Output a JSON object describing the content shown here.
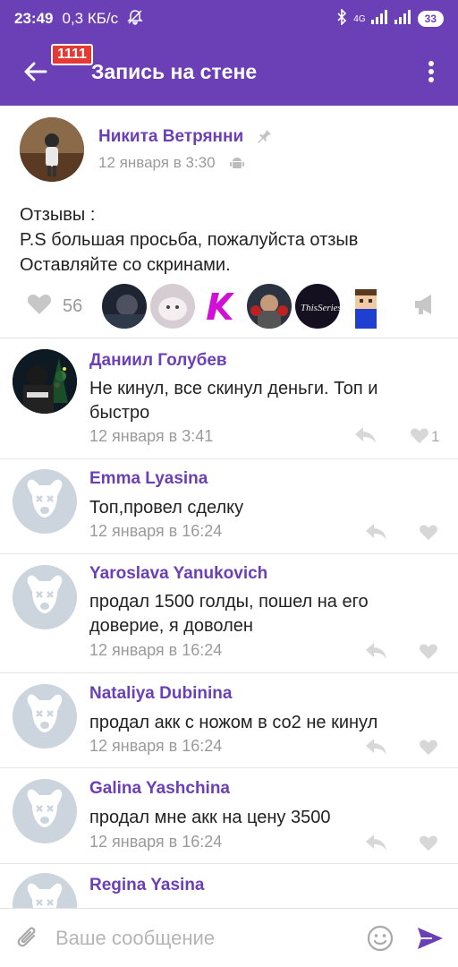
{
  "status_bar": {
    "time": "23:49",
    "speed": "0,3 КБ/с",
    "network": "4G",
    "battery": "33"
  },
  "app_bar": {
    "title": "Запись на стене",
    "badge": "1111"
  },
  "post": {
    "author": "Никита Ветрянни",
    "date": "12 января в 3:30",
    "text_lines": [
      "Отзывы :",
      "P.S большая просьба, пожалуйста отзыв",
      "Оставляйте со скринами."
    ],
    "likes_count": "56",
    "likers": [
      "dark-photo",
      "cat-photo",
      "kantik-logo",
      "fighter-photo",
      "dark-logo",
      "pixel-avatar"
    ]
  },
  "comments": [
    {
      "name": "Даниил Голубев",
      "text": "Не кинул, все скинул деньги. Топ и быстро",
      "date": "12 января в 3:41",
      "likes": "1",
      "avatar": "photo"
    },
    {
      "name": "Emma Lyasina",
      "text": "Топ,провел сделку",
      "date": "12 января в 16:24",
      "likes": "",
      "avatar": "default-dog"
    },
    {
      "name": "Yaroslava Yanukovich",
      "text": "продал 1500 голды, пошел на его доверие, я доволен",
      "date": "12 января в 16:24",
      "likes": "",
      "avatar": "default-dog"
    },
    {
      "name": "Nataliya Dubinina",
      "text": "продал акк  с ножом в со2 не кинул",
      "date": "12 января в 16:24",
      "likes": "",
      "avatar": "default-dog"
    },
    {
      "name": "Galina Yashchina",
      "text": "продал мне акк на цену 3500",
      "date": "12 января в 16:24",
      "likes": "",
      "avatar": "default-dog"
    },
    {
      "name": "Regina Yasina",
      "text": "",
      "date": "",
      "likes": "",
      "avatar": "default-dog"
    }
  ],
  "composer": {
    "placeholder": "Ваше сообщение"
  },
  "colors": {
    "accent": "#6b3fb6",
    "muted": "#9a9a9a",
    "default_avatar": "#ccd4dd"
  }
}
